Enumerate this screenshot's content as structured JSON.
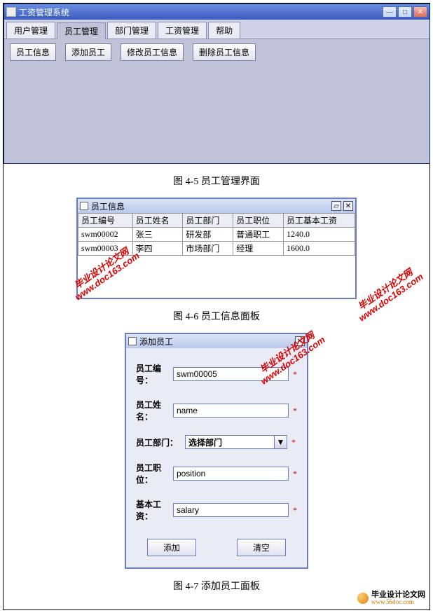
{
  "fig1": {
    "title": "工资管理系统",
    "tabs": [
      "用户管理",
      "员工管理",
      "部门管理",
      "工资管理",
      "帮助"
    ],
    "active_tab_index": 1,
    "toolbar": [
      "员工信息",
      "添加员工",
      "修改员工信息",
      "删除员工信息"
    ],
    "caption": "图 4-5 员工管理界面"
  },
  "fig2": {
    "title": "员工信息",
    "columns": [
      "员工编号",
      "员工姓名",
      "员工部门",
      "员工职位",
      "员工基本工资"
    ],
    "rows": [
      [
        "swm00002",
        "张三",
        "研发部",
        "普通职工",
        "1240.0"
      ],
      [
        "swm00003",
        "李四",
        "市场部门",
        "经理",
        "1600.0"
      ]
    ],
    "caption": "图 4-6 员工信息面板"
  },
  "fig3": {
    "title": "添加员工",
    "fields": [
      {
        "label": "员工编号：",
        "value": "swm00005",
        "type": "text",
        "required": true
      },
      {
        "label": "员工姓名：",
        "value": "name",
        "type": "text",
        "required": true
      },
      {
        "label": "员工部门：",
        "value": "选择部门",
        "type": "select",
        "required": true
      },
      {
        "label": "员工职位：",
        "value": "position",
        "type": "text",
        "required": true
      },
      {
        "label": "基本工资：",
        "value": "salary",
        "type": "text",
        "required": true
      }
    ],
    "submit": "添加",
    "reset": "清空",
    "caption": "图 4-7 添加员工面板"
  },
  "watermark": {
    "line1": "毕业设计论文网",
    "line2": "www.doc163.com"
  },
  "footer": {
    "line1": "毕业设计论文网",
    "line2": "www.56doc.com"
  }
}
